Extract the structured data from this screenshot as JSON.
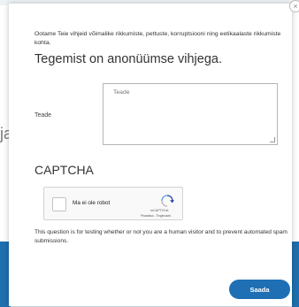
{
  "background": {
    "fragment_text": "ja"
  },
  "modal": {
    "intro": "Ootame Teie vihjeid võimalike rikkumiste, pettuste, korruptsiooni ning eetikaalaste rikkumiste kohta.",
    "heading": "Tegemist on anonüümse vihjega.",
    "message_label": "Teade",
    "message_placeholder": "Teade",
    "captcha_title": "CAPTCHA",
    "recaptcha": {
      "checkbox_label": "Ma ei ole robot",
      "brand": "reCAPTCHA",
      "terms": "Privaatsus - Tingimused"
    },
    "captcha_explanation": "This question is for testing whether or not you are a human visitor and to prevent automated spam submissions.",
    "submit_label": "Saada"
  },
  "colors": {
    "accent": "#1f6fb5",
    "background_strip": "#d9eaf1"
  },
  "icons": {
    "close": "close-icon",
    "recaptcha": "recaptcha-logo-icon"
  }
}
